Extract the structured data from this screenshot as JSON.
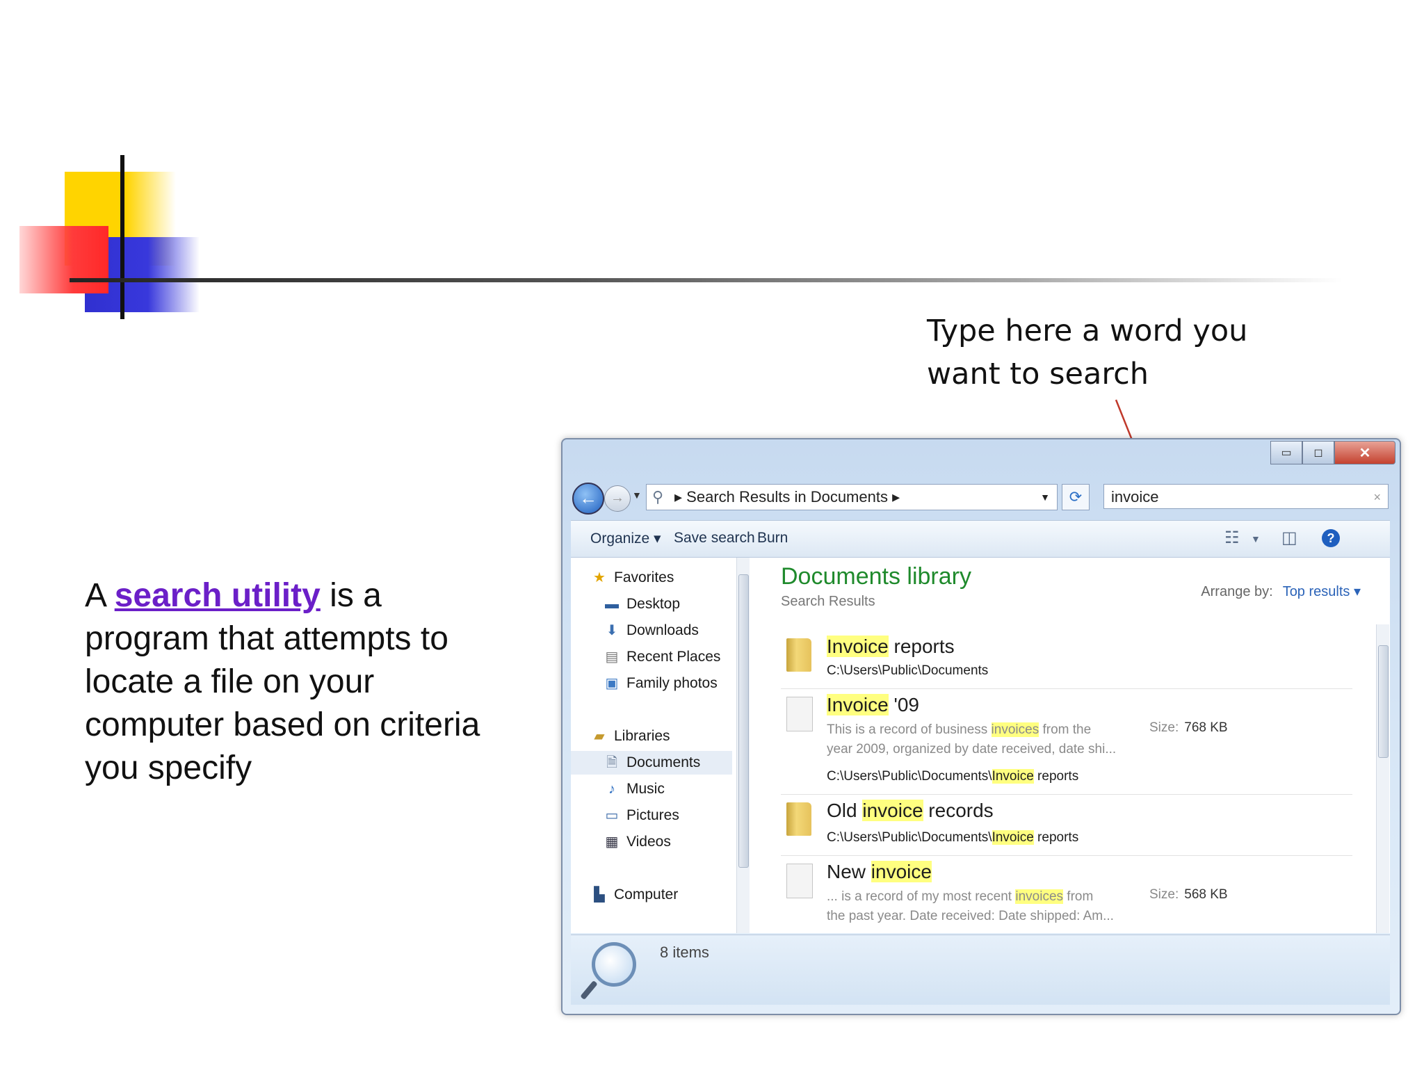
{
  "callout": {
    "line1": "Type here a word you",
    "line2": "want to search"
  },
  "body": {
    "prefix": "A ",
    "link": "search utility",
    "line1_rest": " is a",
    "line2": "program that attempts to",
    "line3": "locate a file on your",
    "line4": "computer based on criteria",
    "line5": "you specify"
  },
  "window": {
    "caption_buttons": {
      "minimize": "▭",
      "maximize": "◻",
      "close": "✕"
    },
    "address": {
      "breadcrumb": "Search Results in Documents",
      "separator": "▸",
      "icon": "search-icon"
    },
    "search": {
      "value": "invoice",
      "clear": "×"
    },
    "toolbar": {
      "organize": "Organize ▾",
      "save_search": "Save search",
      "burn": "Burn",
      "help": "?"
    },
    "nav": {
      "favorites": "Favorites",
      "desktop": "Desktop",
      "downloads": "Downloads",
      "recent_places": "Recent Places",
      "family_photos": "Family photos",
      "libraries": "Libraries",
      "documents": "Documents",
      "music": "Music",
      "pictures": "Pictures",
      "videos": "Videos",
      "computer": "Computer"
    },
    "library": {
      "title": "Documents library",
      "subtitle": "Search Results",
      "arrange_label": "Arrange by:",
      "arrange_value": "Top results ▾"
    },
    "results": [
      {
        "pre": "",
        "hl": "Invoice",
        "post": " reports",
        "path": "C:\\Users\\Public\\Documents",
        "type": "folder"
      },
      {
        "pre": "",
        "hl": "Invoice",
        "post": " '09",
        "desc1_pre": "This is a record of business ",
        "desc1_hl": "invoices",
        "desc1_post": " from the",
        "desc2": "year 2009, organized by date received, date shi...",
        "path_pre": "C:\\Users\\Public\\Documents\\",
        "path_hl": "Invoice",
        "path_post": " reports",
        "size_label": "Size:",
        "size_value": "768 KB",
        "type": "document"
      },
      {
        "pre": "Old ",
        "hl": "invoice",
        "post": " records",
        "path_pre": "C:\\Users\\Public\\Documents\\",
        "path_hl": "Invoice",
        "path_post": " reports",
        "type": "folder"
      },
      {
        "pre": "New ",
        "hl": "invoice",
        "post": "",
        "desc1_pre": "... is a record of my most recent ",
        "desc1_hl": "invoices",
        "desc1_post": " from",
        "desc2": "the past year. Date received: Date shipped: Am...",
        "size_label": "Size:",
        "size_value": "568 KB",
        "type": "document"
      }
    ],
    "status": {
      "count": "8 items"
    }
  },
  "colors": {
    "link": "#6b1fc8",
    "library_title": "#1f8a2c",
    "highlight": "#ffff80",
    "arrow": "#c0392b"
  }
}
